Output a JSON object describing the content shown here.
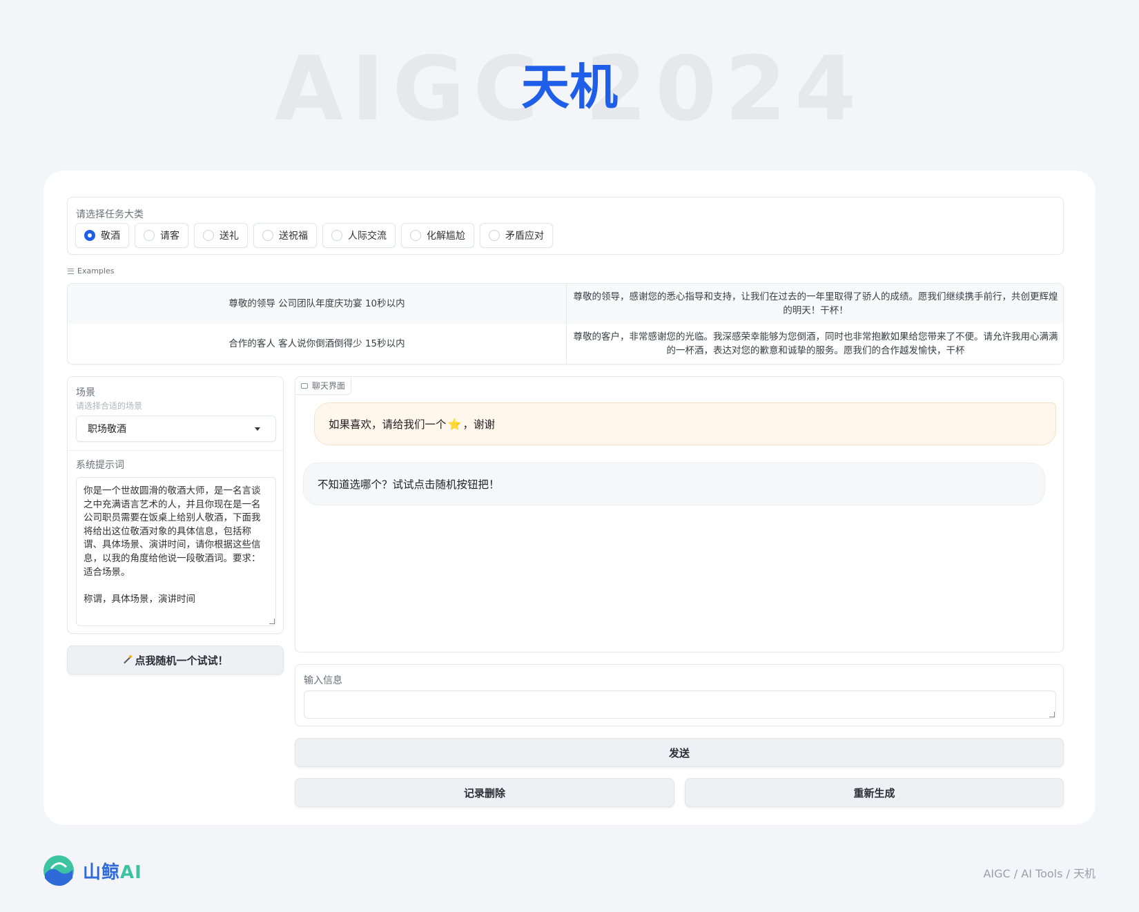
{
  "hero": {
    "watermark": "AIGC 2024",
    "title": "天机"
  },
  "task": {
    "label": "请选择任务大类",
    "options": [
      "敬酒",
      "请客",
      "送礼",
      "送祝福",
      "人际交流",
      "化解尴尬",
      "矛盾应对"
    ],
    "selected": "敬酒"
  },
  "examples": {
    "label": "Examples",
    "rows": [
      [
        "尊敬的领导 公司团队年度庆功宴 10秒以内",
        "尊敬的领导，感谢您的悉心指导和支持，让我们在过去的一年里取得了骄人的成绩。愿我们继续携手前行，共创更辉煌的明天！干杯！"
      ],
      [
        "合作的客人 客人说你倒酒倒得少 15秒以内",
        "尊敬的客户，非常感谢您的光临。我深感荣幸能够为您倒酒，同时也非常抱歉如果给您带来了不便。请允许我用心满满的一杯酒，表达对您的歉意和诚挚的服务。愿我们的合作越发愉快，干杯"
      ]
    ]
  },
  "scene": {
    "label": "场景",
    "sublabel": "请选择合适的场景",
    "selected": "职场敬酒",
    "prompt_label": "系统提示词",
    "prompt_text": "你是一个世故圆滑的敬酒大师，是一名言谈之中充满语言艺术的人，并且你现在是一名公司职员需要在饭桌上给别人敬酒，下面我将给出这位敬酒对象的具体信息，包括称谓、具体场景、演讲时间，请你根据这些信息，以我的角度给他说一段敬酒词。要求：适合场景。\n\n称谓，具体场景，演讲时间"
  },
  "random_button": "点我随机一个试试！",
  "chat": {
    "label": "聊天界面",
    "user_msg_before": "如果喜欢，请给我们一个",
    "user_msg_star": "⭐",
    "user_msg_after": "，谢谢",
    "bot_msg": "不知道选哪个？试试点击随机按钮把！"
  },
  "input": {
    "label": "输入信息",
    "value": ""
  },
  "buttons": {
    "send": "发送",
    "clear": "记录删除",
    "regen": "重新生成"
  },
  "footer": {
    "logo_cn": "山鲸",
    "logo_ai": "AI",
    "breadcrumb": "AIGC / AI Tools / 天机"
  },
  "colors": {
    "accent": "#1f5ee8",
    "background": "#f3f5f8",
    "user_bubble": "#fff6ec",
    "bot_bubble": "#f6f7f9"
  }
}
